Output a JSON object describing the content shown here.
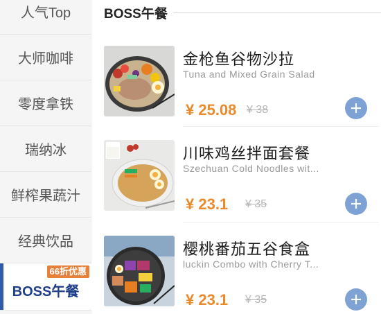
{
  "sidebar": {
    "items": [
      {
        "label": "人气Top"
      },
      {
        "label": "大师咖啡"
      },
      {
        "label": "零度拿铁"
      },
      {
        "label": "瑞纳冰"
      },
      {
        "label": "鲜榨果蔬汁"
      },
      {
        "label": "经典饮品"
      },
      {
        "label": "BOSS午餐",
        "badge": "66折优惠"
      }
    ],
    "active_index": 6
  },
  "section": {
    "title": "BOSS午餐"
  },
  "products": [
    {
      "name": "金枪鱼谷物沙拉",
      "english": "Tuna and Mixed Grain Salad",
      "price": "¥ 25.08",
      "original_price": "¥ 38"
    },
    {
      "name": "川味鸡丝拌面套餐",
      "english": "Szechuan Cold Noodles wit...",
      "price": "¥ 23.1",
      "original_price": "¥ 35"
    },
    {
      "name": "樱桃番茄五谷食盒",
      "english": "luckin Combo with Cherry T...",
      "price": "¥ 23.1",
      "original_price": "¥ 35"
    }
  ],
  "icons": {
    "add": "plus-circle-icon"
  },
  "colors": {
    "accent": "#2f5ba8",
    "price": "#e98a2c",
    "add_button": "#7ea2d3",
    "badge": "#e7803a"
  }
}
